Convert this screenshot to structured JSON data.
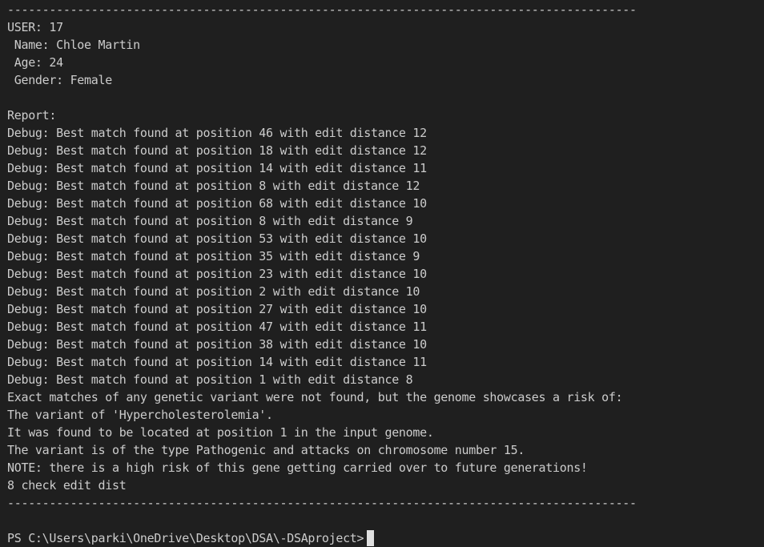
{
  "terminal": {
    "separator_top": "------------------------------------------------------------------------------------------",
    "user_header": "USER: 17",
    "name_line": " Name: Chloe Martin",
    "age_line": " Age: 24",
    "gender_line": " Gender: Female",
    "report_label": "Report:",
    "debug_lines": [
      "Debug: Best match found at position 46 with edit distance 12",
      "Debug: Best match found at position 18 with edit distance 12",
      "Debug: Best match found at position 14 with edit distance 11",
      "Debug: Best match found at position 8 with edit distance 12",
      "Debug: Best match found at position 68 with edit distance 10",
      "Debug: Best match found at position 8 with edit distance 9",
      "Debug: Best match found at position 53 with edit distance 10",
      "Debug: Best match found at position 35 with edit distance 9",
      "Debug: Best match found at position 23 with edit distance 10",
      "Debug: Best match found at position 2 with edit distance 10",
      "Debug: Best match found at position 27 with edit distance 10",
      "Debug: Best match found at position 47 with edit distance 11",
      "Debug: Best match found at position 38 with edit distance 10",
      "Debug: Best match found at position 14 with edit distance 11",
      "Debug: Best match found at position 1 with edit distance 8"
    ],
    "result_lines": [
      "Exact matches of any genetic variant were not found, but the genome showcases a risk of:",
      "The variant of 'Hypercholesterolemia'.",
      "It was found to be located at position 1 in the input genome.",
      "The variant is of the type Pathogenic and attacks on chromosome number 15.",
      "NOTE: there is a high risk of this gene getting carried over to future generations!",
      "8 check edit dist"
    ],
    "separator_bottom": "------------------------------------------------------------------------------------------",
    "prompt": "PS C:\\Users\\parki\\OneDrive\\Desktop\\DSA\\-DSAproject>"
  },
  "colors": {
    "background": "#1f1f1f",
    "text": "#cccccc",
    "cursor": "#e0e0e0"
  }
}
